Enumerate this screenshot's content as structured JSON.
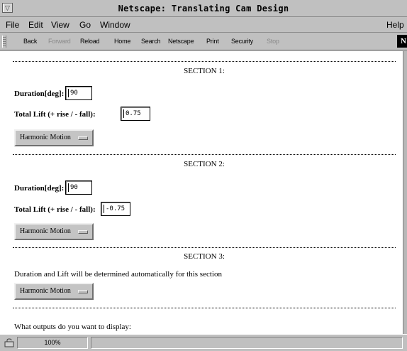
{
  "window": {
    "title": "Netscape: Translating Cam Design"
  },
  "menu": {
    "items": [
      "File",
      "Edit",
      "View",
      "Go",
      "Window"
    ],
    "help": "Help"
  },
  "toolbar": {
    "back": "Back",
    "forward": "Forward",
    "reload": "Reload",
    "home": "Home",
    "search": "Search",
    "netscape": "Netscape",
    "print": "Print",
    "security": "Security",
    "stop": "Stop"
  },
  "sections": [
    {
      "title": "SECTION 1:",
      "duration_label": "Duration[deg]:",
      "duration_value": "90",
      "lift_label": "Total Lift (+ rise / - fall):",
      "lift_value": "0.75",
      "motion": "Harmonic Motion"
    },
    {
      "title": "SECTION 2:",
      "duration_label": "Duration[deg]:",
      "duration_value": "90",
      "lift_label": "Total Lift (+ rise / - fall):",
      "lift_value": "-0.75",
      "motion": "Harmonic Motion"
    },
    {
      "title": "SECTION 3:",
      "note": "Duration and Lift will be determined automatically for this section",
      "motion": "Harmonic Motion"
    }
  ],
  "outputs_prompt": "What outputs do you want to display:",
  "status": {
    "zoom": "100%",
    "message": ""
  },
  "icons": {
    "system_menu": "window-menu-icon",
    "logo": "netscape-logo-icon",
    "security": "security-lock-icon"
  }
}
